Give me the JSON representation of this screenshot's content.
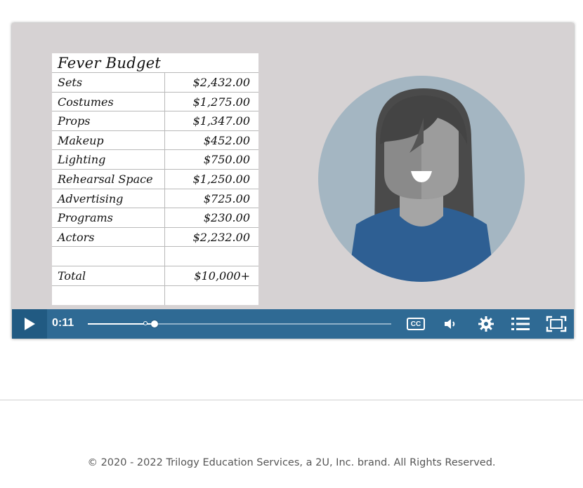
{
  "video": {
    "sheet": {
      "title": "Fever Budget",
      "rows": [
        {
          "label": "Sets",
          "amount": "$2,432.00"
        },
        {
          "label": "Costumes",
          "amount": "$1,275.00"
        },
        {
          "label": "Props",
          "amount": "$1,347.00"
        },
        {
          "label": "Makeup",
          "amount": "$452.00"
        },
        {
          "label": "Lighting",
          "amount": "$750.00"
        },
        {
          "label": "Rehearsal Space",
          "amount": "$1,250.00"
        },
        {
          "label": "Advertising",
          "amount": "$725.00"
        },
        {
          "label": "Programs",
          "amount": "$230.00"
        },
        {
          "label": "Actors",
          "amount": "$2,232.00"
        },
        {
          "label": "",
          "amount": ""
        },
        {
          "label": "Total",
          "amount": "$10,000+"
        },
        {
          "label": "",
          "amount": ""
        }
      ]
    }
  },
  "controls": {
    "play_icon": "play-icon",
    "time": "0:11",
    "progress_fraction": 0.22,
    "buffered_fraction": 0.19,
    "captions_label": "CC",
    "icons": [
      "captions-icon",
      "volume-icon",
      "settings-gear-icon",
      "chapters-list-icon",
      "fullscreen-icon"
    ],
    "accent": "#2f6a94"
  },
  "footer": {
    "copyright": "© 2020 - 2022 Trilogy Education Services, a 2U, Inc. brand. All Rights Reserved."
  }
}
